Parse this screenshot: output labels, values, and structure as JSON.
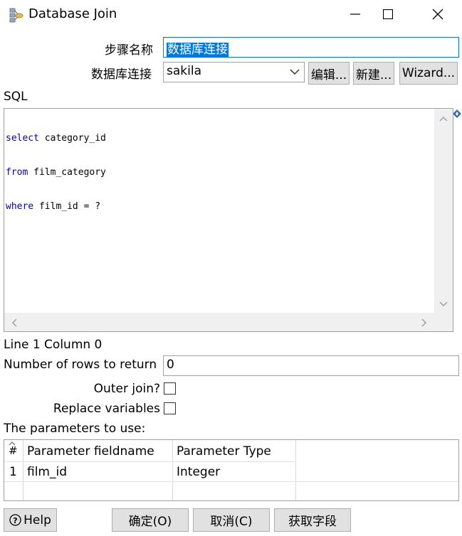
{
  "window": {
    "title": "Database Join"
  },
  "step_name": {
    "label": "步骤名称",
    "value": "数据库连接"
  },
  "connection": {
    "label": "数据库连接",
    "value": "sakila",
    "edit_label": "编辑...",
    "new_label": "新建...",
    "wizard_label": "Wizard..."
  },
  "sql": {
    "label": "SQL",
    "lines": [
      {
        "keyword": "select",
        "rest": " category_id"
      },
      {
        "keyword": "from",
        "rest": " film_category"
      },
      {
        "keyword": "where",
        "rest": " film_id = ?"
      }
    ]
  },
  "status": {
    "position": "Line 1 Column 0"
  },
  "rows_to_return": {
    "label": "Number of rows to return",
    "value": "0"
  },
  "outer_join": {
    "label": "Outer join?",
    "checked": false
  },
  "replace_variables": {
    "label": "Replace variables",
    "checked": false
  },
  "parameters": {
    "label": "The parameters to use:",
    "columns": [
      "#",
      "Parameter fieldname",
      "Parameter Type"
    ],
    "rows": [
      {
        "num": "1",
        "fieldname": "film_id",
        "type": "Integer"
      }
    ]
  },
  "footer": {
    "help_label": "Help",
    "ok_label": "确定(O)",
    "cancel_label": "取消(C)",
    "get_fields_label": "获取字段"
  }
}
